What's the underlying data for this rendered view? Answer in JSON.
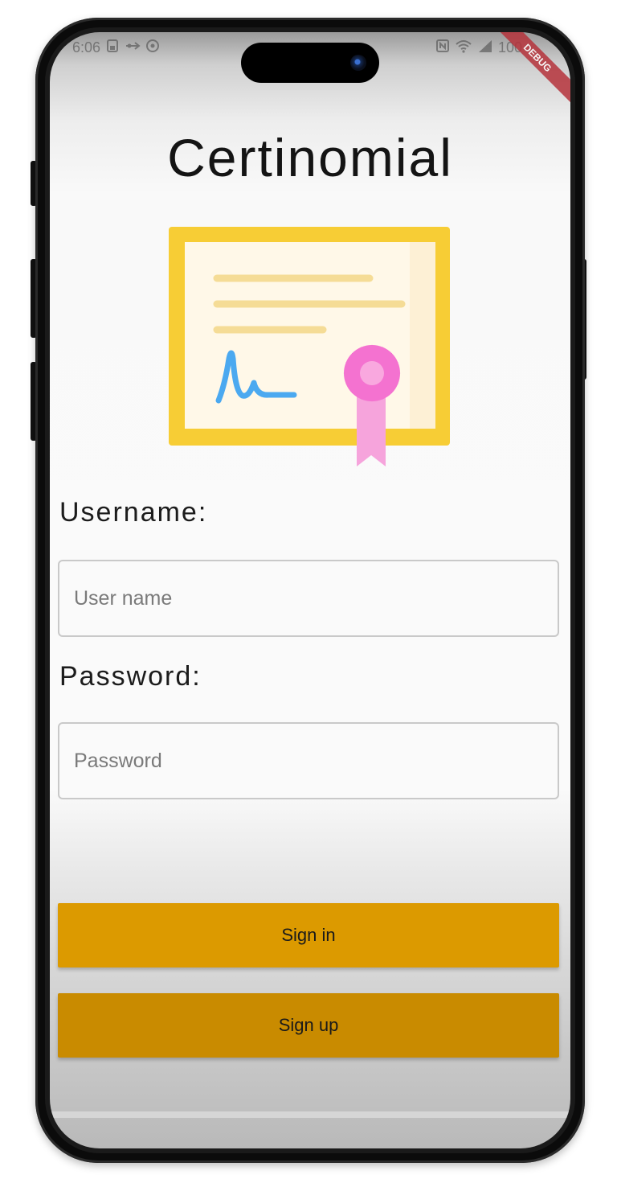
{
  "status_bar": {
    "time": "6:06",
    "left_icons": [
      "sim-card-icon",
      "usb-icon",
      "sync-icon"
    ],
    "right_icons": [
      "nfc-icon",
      "wifi-icon",
      "signal-icon"
    ],
    "battery": "100",
    "debug_banner": "DEBUG"
  },
  "app": {
    "title": "Certinomial",
    "illustration": "certificate-icon"
  },
  "form": {
    "username_label": "Username:",
    "username_placeholder": "User name",
    "username_value": "",
    "password_label": "Password:",
    "password_placeholder": "Password",
    "password_value": ""
  },
  "actions": {
    "sign_in_label": "Sign in",
    "sign_up_label": "Sign up"
  },
  "colors": {
    "sign_in_button": "#dc9a00",
    "sign_up_button": "#c98b00",
    "certificate_frame": "#f7cd35",
    "certificate_paper": "#fff8e8",
    "certificate_lines": "#f5dc96",
    "signature": "#4ba9f0",
    "seal": "#f472d0",
    "ribbon": "#f6a4dc",
    "debug_ribbon": "#b5333b"
  }
}
